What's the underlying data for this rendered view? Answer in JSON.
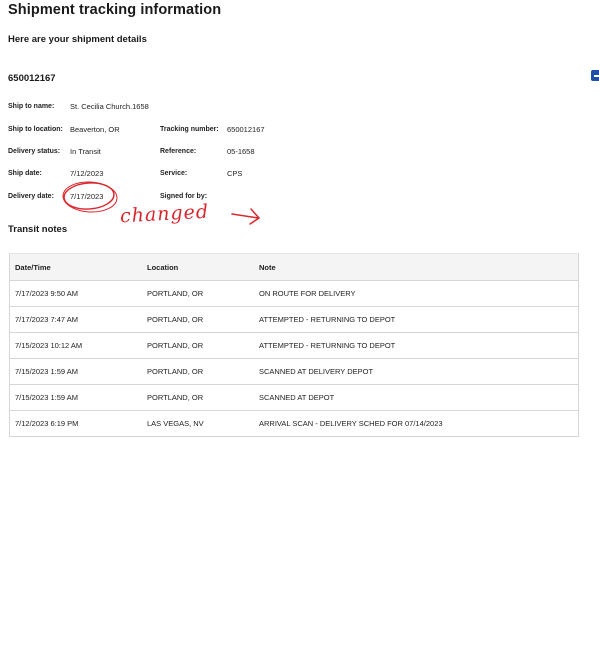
{
  "header": {
    "title": "Shipment tracking information",
    "subtitle": "Here are your shipment details"
  },
  "shipment": {
    "tracking_heading": "650012167",
    "details": {
      "ship_to_name_label": "Ship to name:",
      "ship_to_name": "St. Cecilia Church.1658",
      "ship_to_location_label": "Ship to location:",
      "ship_to_location": "Beaverton, OR",
      "tracking_number_label": "Tracking number:",
      "tracking_number": "650012167",
      "delivery_status_label": "Delivery status:",
      "delivery_status": "In Transit",
      "reference_label": "Reference:",
      "reference": "05-1658",
      "ship_date_label": "Ship date:",
      "ship_date": "7/12/2023",
      "service_label": "Service:",
      "service": "CPS",
      "delivery_date_label": "Delivery date:",
      "delivery_date": "7/17/2023",
      "signed_for_by_label": "Signed for by:",
      "signed_for_by": ""
    }
  },
  "transit": {
    "heading": "Transit notes",
    "columns": [
      "Date/Time",
      "Location",
      "Note"
    ],
    "rows": [
      [
        "7/17/2023 9:50 AM",
        "PORTLAND, OR",
        "ON ROUTE FOR DELIVERY"
      ],
      [
        "7/17/2023 7:47 AM",
        "PORTLAND, OR",
        "ATTEMPTED - RETURNING TO DEPOT"
      ],
      [
        "7/15/2023 10:12 AM",
        "PORTLAND, OR",
        "ATTEMPTED - RETURNING TO DEPOT"
      ],
      [
        "7/15/2023 1:59 AM",
        "PORTLAND, OR",
        "SCANNED AT DELIVERY DEPOT"
      ],
      [
        "7/15/2023 1:59 AM",
        "PORTLAND, OR",
        "SCANNED AT DEPOT"
      ],
      [
        "7/12/2023 6:19 PM",
        "LAS VEGAS, NV",
        "ARRIVAL SCAN - DELIVERY SCHED FOR 07/14/2023"
      ]
    ]
  },
  "annotation": {
    "text": "changed",
    "color": "#d8282e"
  },
  "colors": {
    "toggle": "#1f4fa8",
    "table_header_bg": "#f4f4f4",
    "border": "#d6d6d6"
  },
  "icons": {
    "expand_toggle": "collapse-minus-icon"
  }
}
